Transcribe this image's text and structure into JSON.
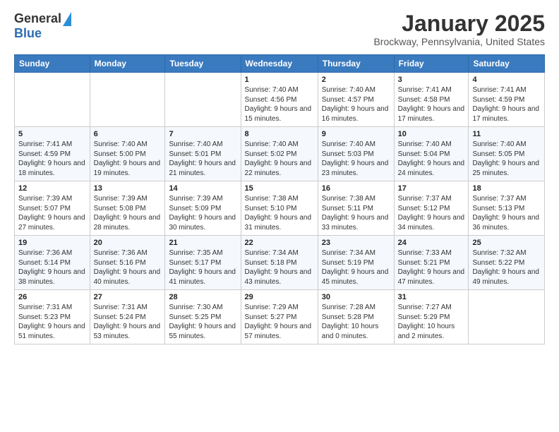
{
  "header": {
    "logo_general": "General",
    "logo_blue": "Blue",
    "month_title": "January 2025",
    "location": "Brockway, Pennsylvania, United States"
  },
  "days_of_week": [
    "Sunday",
    "Monday",
    "Tuesday",
    "Wednesday",
    "Thursday",
    "Friday",
    "Saturday"
  ],
  "weeks": [
    {
      "cells": [
        {
          "day": "",
          "info": ""
        },
        {
          "day": "",
          "info": ""
        },
        {
          "day": "",
          "info": ""
        },
        {
          "day": "1",
          "info": "Sunrise: 7:40 AM\nSunset: 4:56 PM\nDaylight: 9 hours and 15 minutes."
        },
        {
          "day": "2",
          "info": "Sunrise: 7:40 AM\nSunset: 4:57 PM\nDaylight: 9 hours and 16 minutes."
        },
        {
          "day": "3",
          "info": "Sunrise: 7:41 AM\nSunset: 4:58 PM\nDaylight: 9 hours and 17 minutes."
        },
        {
          "day": "4",
          "info": "Sunrise: 7:41 AM\nSunset: 4:59 PM\nDaylight: 9 hours and 17 minutes."
        }
      ]
    },
    {
      "cells": [
        {
          "day": "5",
          "info": "Sunrise: 7:41 AM\nSunset: 4:59 PM\nDaylight: 9 hours and 18 minutes."
        },
        {
          "day": "6",
          "info": "Sunrise: 7:40 AM\nSunset: 5:00 PM\nDaylight: 9 hours and 19 minutes."
        },
        {
          "day": "7",
          "info": "Sunrise: 7:40 AM\nSunset: 5:01 PM\nDaylight: 9 hours and 21 minutes."
        },
        {
          "day": "8",
          "info": "Sunrise: 7:40 AM\nSunset: 5:02 PM\nDaylight: 9 hours and 22 minutes."
        },
        {
          "day": "9",
          "info": "Sunrise: 7:40 AM\nSunset: 5:03 PM\nDaylight: 9 hours and 23 minutes."
        },
        {
          "day": "10",
          "info": "Sunrise: 7:40 AM\nSunset: 5:04 PM\nDaylight: 9 hours and 24 minutes."
        },
        {
          "day": "11",
          "info": "Sunrise: 7:40 AM\nSunset: 5:05 PM\nDaylight: 9 hours and 25 minutes."
        }
      ]
    },
    {
      "cells": [
        {
          "day": "12",
          "info": "Sunrise: 7:39 AM\nSunset: 5:07 PM\nDaylight: 9 hours and 27 minutes."
        },
        {
          "day": "13",
          "info": "Sunrise: 7:39 AM\nSunset: 5:08 PM\nDaylight: 9 hours and 28 minutes."
        },
        {
          "day": "14",
          "info": "Sunrise: 7:39 AM\nSunset: 5:09 PM\nDaylight: 9 hours and 30 minutes."
        },
        {
          "day": "15",
          "info": "Sunrise: 7:38 AM\nSunset: 5:10 PM\nDaylight: 9 hours and 31 minutes."
        },
        {
          "day": "16",
          "info": "Sunrise: 7:38 AM\nSunset: 5:11 PM\nDaylight: 9 hours and 33 minutes."
        },
        {
          "day": "17",
          "info": "Sunrise: 7:37 AM\nSunset: 5:12 PM\nDaylight: 9 hours and 34 minutes."
        },
        {
          "day": "18",
          "info": "Sunrise: 7:37 AM\nSunset: 5:13 PM\nDaylight: 9 hours and 36 minutes."
        }
      ]
    },
    {
      "cells": [
        {
          "day": "19",
          "info": "Sunrise: 7:36 AM\nSunset: 5:14 PM\nDaylight: 9 hours and 38 minutes."
        },
        {
          "day": "20",
          "info": "Sunrise: 7:36 AM\nSunset: 5:16 PM\nDaylight: 9 hours and 40 minutes."
        },
        {
          "day": "21",
          "info": "Sunrise: 7:35 AM\nSunset: 5:17 PM\nDaylight: 9 hours and 41 minutes."
        },
        {
          "day": "22",
          "info": "Sunrise: 7:34 AM\nSunset: 5:18 PM\nDaylight: 9 hours and 43 minutes."
        },
        {
          "day": "23",
          "info": "Sunrise: 7:34 AM\nSunset: 5:19 PM\nDaylight: 9 hours and 45 minutes."
        },
        {
          "day": "24",
          "info": "Sunrise: 7:33 AM\nSunset: 5:21 PM\nDaylight: 9 hours and 47 minutes."
        },
        {
          "day": "25",
          "info": "Sunrise: 7:32 AM\nSunset: 5:22 PM\nDaylight: 9 hours and 49 minutes."
        }
      ]
    },
    {
      "cells": [
        {
          "day": "26",
          "info": "Sunrise: 7:31 AM\nSunset: 5:23 PM\nDaylight: 9 hours and 51 minutes."
        },
        {
          "day": "27",
          "info": "Sunrise: 7:31 AM\nSunset: 5:24 PM\nDaylight: 9 hours and 53 minutes."
        },
        {
          "day": "28",
          "info": "Sunrise: 7:30 AM\nSunset: 5:25 PM\nDaylight: 9 hours and 55 minutes."
        },
        {
          "day": "29",
          "info": "Sunrise: 7:29 AM\nSunset: 5:27 PM\nDaylight: 9 hours and 57 minutes."
        },
        {
          "day": "30",
          "info": "Sunrise: 7:28 AM\nSunset: 5:28 PM\nDaylight: 10 hours and 0 minutes."
        },
        {
          "day": "31",
          "info": "Sunrise: 7:27 AM\nSunset: 5:29 PM\nDaylight: 10 hours and 2 minutes."
        },
        {
          "day": "",
          "info": ""
        }
      ]
    }
  ]
}
